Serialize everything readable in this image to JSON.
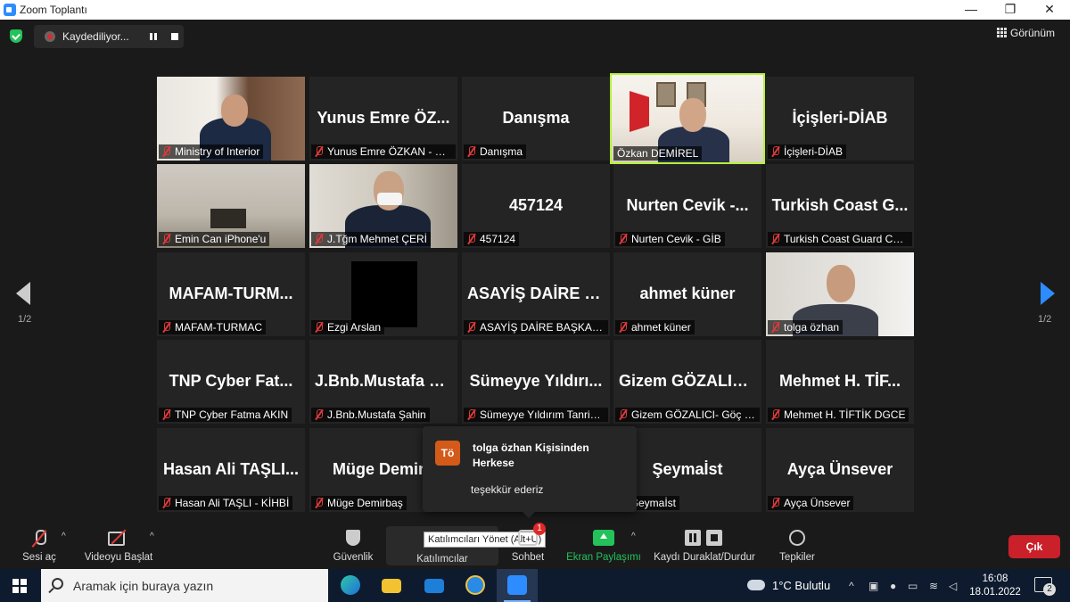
{
  "window": {
    "title": "Zoom Toplantı",
    "minimize": "—",
    "restore": "❐",
    "close": "✕"
  },
  "recording": {
    "label": "Kaydediliyor..."
  },
  "view_button": {
    "label": "Görünüm"
  },
  "pagination": {
    "left": "1/2",
    "right": "1/2"
  },
  "tiles": [
    {
      "big": "",
      "label": "Ministry of Interior"
    },
    {
      "big": "Yunus Emre ÖZ...",
      "label": "Yunus Emre ÖZKAN - MoI"
    },
    {
      "big": "Danışma",
      "label": "Danışma"
    },
    {
      "big": "",
      "label": "Özkan DEMİREL"
    },
    {
      "big": "İçişleri-DİAB",
      "label": "İçişleri-DİAB"
    },
    {
      "big": "",
      "label": "Emin Can iPhone'u"
    },
    {
      "big": "",
      "label": "J.Tğm Mehmet ÇERİ"
    },
    {
      "big": "457124",
      "label": "457124"
    },
    {
      "big": "Nurten Cevik -...",
      "label": "Nurten Cevik - GİB"
    },
    {
      "big": "Turkish Coast G...",
      "label": "Turkish Coast Guard Com..."
    },
    {
      "big": "MAFAM-TURM...",
      "label": "MAFAM-TURMAC"
    },
    {
      "big": "",
      "label": "Ezgi Arslan"
    },
    {
      "big": "ASAYİŞ DAİRE B...",
      "label": "ASAYİŞ DAİRE BAŞKANLIĞI"
    },
    {
      "big": "ahmet küner",
      "label": "ahmet küner"
    },
    {
      "big": "",
      "label": "tolga özhan"
    },
    {
      "big": "TNP Cyber Fat...",
      "label": "TNP Cyber Fatma AKIN"
    },
    {
      "big": "J.Bnb.Mustafa Ş...",
      "label": "J.Bnb.Mustafa Şahin"
    },
    {
      "big": "Sümeyye Yıldırı...",
      "label": "Sümeyye Yıldırım Tanrive..."
    },
    {
      "big": "Gizem GÖZALIC...",
      "label": "Gizem GÖZALICI- Göç İd..."
    },
    {
      "big": "Mehmet H. TİF...",
      "label": "Mehmet H. TİFTİK DGCE"
    },
    {
      "big": "Hasan Ali TAŞLI...",
      "label": "Hasan Ali TAŞLI - KİHBİ"
    },
    {
      "big": "Müge Demirb",
      "label": "Müge Demirbaş"
    },
    {
      "big": "",
      "label": ""
    },
    {
      "big": "Şeymaİst",
      "label": "Şeymaİst"
    },
    {
      "big": "Ayça Ünsever",
      "label": "Ayça Ünsever"
    }
  ],
  "chat_popup": {
    "avatar": "Tö",
    "from": "tolga özhan Kişisinden Herkese",
    "message": "teşekkür ederiz"
  },
  "toolbar": {
    "mute": "Sesi aç",
    "video": "Videoyu Başlat",
    "security": "Güvenlik",
    "participants": "Katılımcılar",
    "participants_tooltip": "Katılımcıları Yönet (Alt+U)",
    "chat": "Sohbet",
    "chat_badge": "1",
    "share": "Ekran Paylaşımı",
    "record": "Kaydı Duraklat/Durdur",
    "reactions": "Tepkiler",
    "leave": "Çık",
    "caret": "^"
  },
  "taskbar": {
    "search_placeholder": "Aramak için buraya yazın",
    "weather": "1°C  Bulutlu",
    "time": "16:08",
    "date": "18.01.2022",
    "notifications": "2"
  },
  "colors": {
    "speaking_border": "#b6f03a",
    "share_green": "#23c25b",
    "leave_red": "#c9202a",
    "accent_blue": "#2d8cff"
  }
}
